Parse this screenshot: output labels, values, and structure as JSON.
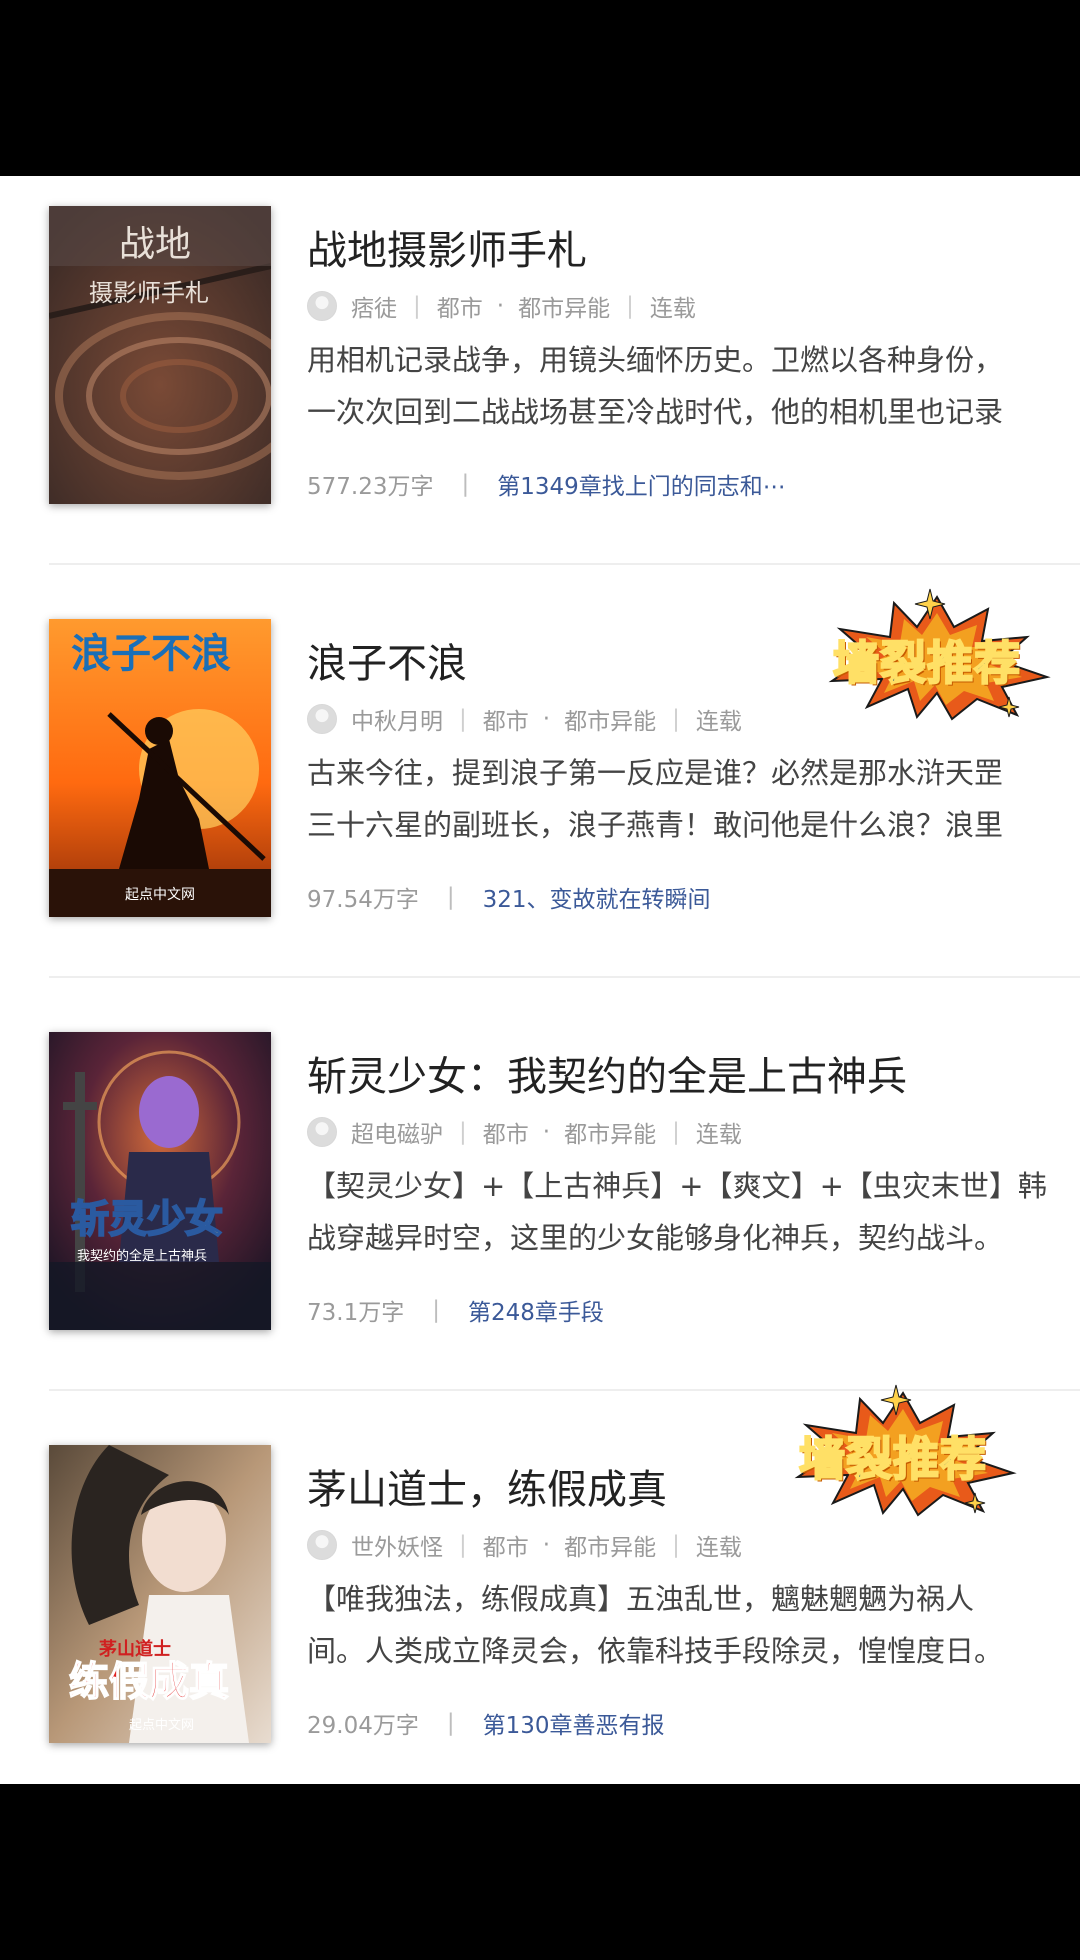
{
  "colors": {
    "link": "#3b5998",
    "badge_text": "#1f4d6b",
    "badge_burst": "#e85a1a"
  },
  "books": [
    {
      "title": "战地摄影师手札",
      "author": "痞徒",
      "category": "都市",
      "subcategory": "都市异能",
      "status": "连载",
      "desc_line1": "用相机记录战争，用镜头缅怀历史。卫燃以各种身份，",
      "desc_line2": "一次次回到二战战场甚至冷战时代，他的相机里也记录",
      "word_count": "577.23万字",
      "latest_chapter": "第1349章找上门的同志和⋯",
      "cover": {
        "title": "战地",
        "subtitle": "摄影师手札"
      },
      "badge": ""
    },
    {
      "title": "浪子不浪",
      "author": "中秋月明",
      "category": "都市",
      "subcategory": "都市异能",
      "status": "连载",
      "desc_line1": "古来今往，提到浪子第一反应是谁？必然是那水浒天罡",
      "desc_line2": "三十六星的副班长，浪子燕青！敢问他是什么浪？浪里",
      "word_count": "97.54万字",
      "latest_chapter": "321、变故就在转瞬间",
      "cover": {
        "title": "浪子不浪",
        "subtitle": "起点中文网"
      },
      "badge": "墙裂推荐"
    },
    {
      "title": "斩灵少女：我契约的全是上古神兵",
      "author": "超电磁驴",
      "category": "都市",
      "subcategory": "都市异能",
      "status": "连载",
      "desc_line1": "【契灵少女】+【上古神兵】+【爽文】+【虫灾末世】韩",
      "desc_line2": "战穿越异时空，这里的少女能够身化神兵，契约战斗。",
      "word_count": "73.1万字",
      "latest_chapter": "第248章手段",
      "cover": {
        "title": "斩灵少女",
        "subtitle": "我契约的全是上古神兵"
      },
      "badge": ""
    },
    {
      "title": "茅山道士，练假成真",
      "author": "世外妖怪",
      "category": "都市",
      "subcategory": "都市异能",
      "status": "连载",
      "desc_line1": "【唯我独法，练假成真】五浊乱世，魑魅魍魉为祸人",
      "desc_line2": "间。人类成立降灵会，依靠科技手段除灵，惶惶度日。",
      "word_count": "29.04万字",
      "latest_chapter": "第130章善恶有报",
      "cover": {
        "title": "练假成真",
        "subtitle": "茅山道士",
        "publisher": "起点中文网"
      },
      "badge": "墙裂推荐"
    }
  ]
}
